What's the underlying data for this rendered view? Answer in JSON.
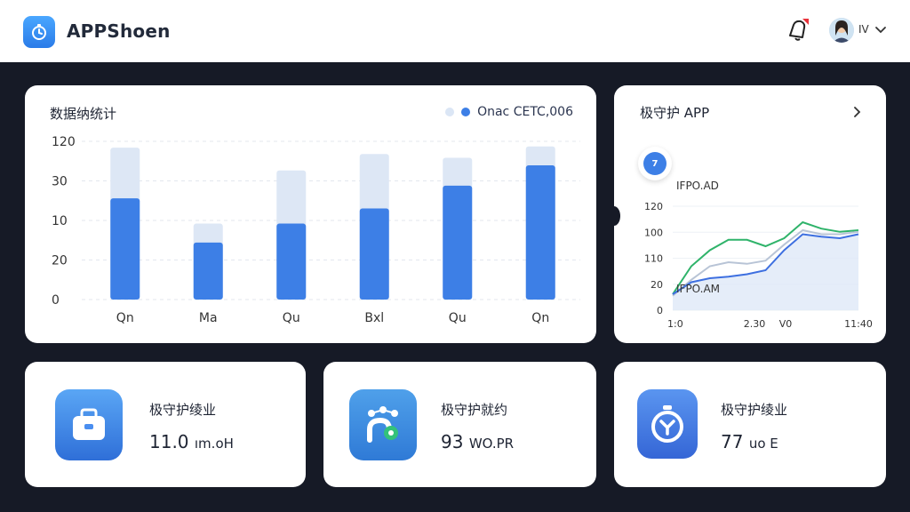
{
  "header": {
    "app_title": "APPShoen",
    "user_name": "IV"
  },
  "main_chart": {
    "title": "数据纳统计",
    "legend_label": "Onac CETC,006"
  },
  "side_chart": {
    "title": "极守护 APP",
    "label_top": "IFPO.AD",
    "label_bottom": "IFPO.AM",
    "badge_text": "7"
  },
  "stats": [
    {
      "label": "极守护绫业",
      "value": "11.0",
      "unit": "ım.oH"
    },
    {
      "label": "极守护就约",
      "value": "93",
      "unit": "WO.PR"
    },
    {
      "label": "极守护绫业",
      "value": "77",
      "unit": "uo E"
    }
  ],
  "colors": {
    "accent": "#3d7fe6",
    "light_bar": "#dbe6f5",
    "green": "#2fb36a",
    "bg": "#161a26"
  },
  "chart_data": [
    {
      "type": "bar",
      "title": "数据纳统计",
      "categories": [
        "Qn",
        "Ma",
        "Qu",
        "Bxl",
        "Qu",
        "Qn"
      ],
      "y_tick_labels": [
        "120",
        "30",
        "10",
        "20",
        "0"
      ],
      "series": [
        {
          "name": "",
          "values": [
            120,
            60,
            102,
            115,
            112,
            121
          ]
        },
        {
          "name": "Onac CETC,006",
          "values": [
            80,
            45,
            60,
            72,
            90,
            106
          ]
        }
      ],
      "ylim": [
        0,
        125
      ],
      "grid": true,
      "legend": "top-right"
    },
    {
      "type": "line",
      "title": "极守护 APP",
      "x_tick_labels": [
        "1:0",
        "2.30",
        "V0",
        "11:40"
      ],
      "y_tick_labels": [
        "120",
        "100",
        "110",
        "20",
        "0"
      ],
      "x": [
        0,
        1,
        2,
        3,
        4,
        5,
        6,
        7,
        8,
        9,
        10
      ],
      "series": [
        {
          "name": "",
          "values": [
            20,
            55,
            75,
            88,
            88,
            80,
            90,
            110,
            102,
            98,
            100
          ]
        },
        {
          "name": "",
          "values": [
            18,
            38,
            55,
            60,
            58,
            62,
            82,
            100,
            95,
            95,
            98
          ]
        },
        {
          "name": "",
          "values": [
            20,
            35,
            40,
            42,
            45,
            50,
            75,
            95,
            92,
            90,
            95
          ]
        }
      ],
      "ylim": [
        0,
        130
      ],
      "grid": true
    }
  ]
}
